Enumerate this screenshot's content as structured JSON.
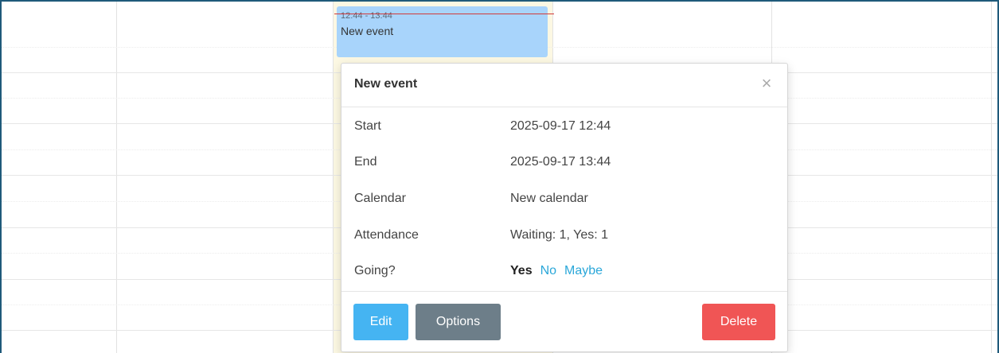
{
  "event_block": {
    "time": "12:44 - 13:44",
    "title": "New event",
    "color": "#a8d4fb"
  },
  "popover": {
    "title": "New event",
    "close_icon": "×",
    "rows": [
      {
        "label": "Start",
        "value": "2025-09-17 12:44"
      },
      {
        "label": "End",
        "value": "2025-09-17 13:44"
      },
      {
        "label": "Calendar",
        "value": "New calendar"
      },
      {
        "label": "Attendance",
        "value": "Waiting: 1, Yes: 1"
      }
    ],
    "going": {
      "label": "Going?",
      "selected": "Yes",
      "option_no": "No",
      "option_maybe": "Maybe"
    },
    "buttons": {
      "edit": "Edit",
      "options": "Options",
      "delete": "Delete"
    }
  },
  "colors": {
    "edit": "#45b4f2",
    "options": "#6d7e89",
    "delete": "#f05555",
    "link": "#2aa7d9",
    "today_highlight": "#fcf8e3",
    "now_indicator": "#d23a3a"
  }
}
